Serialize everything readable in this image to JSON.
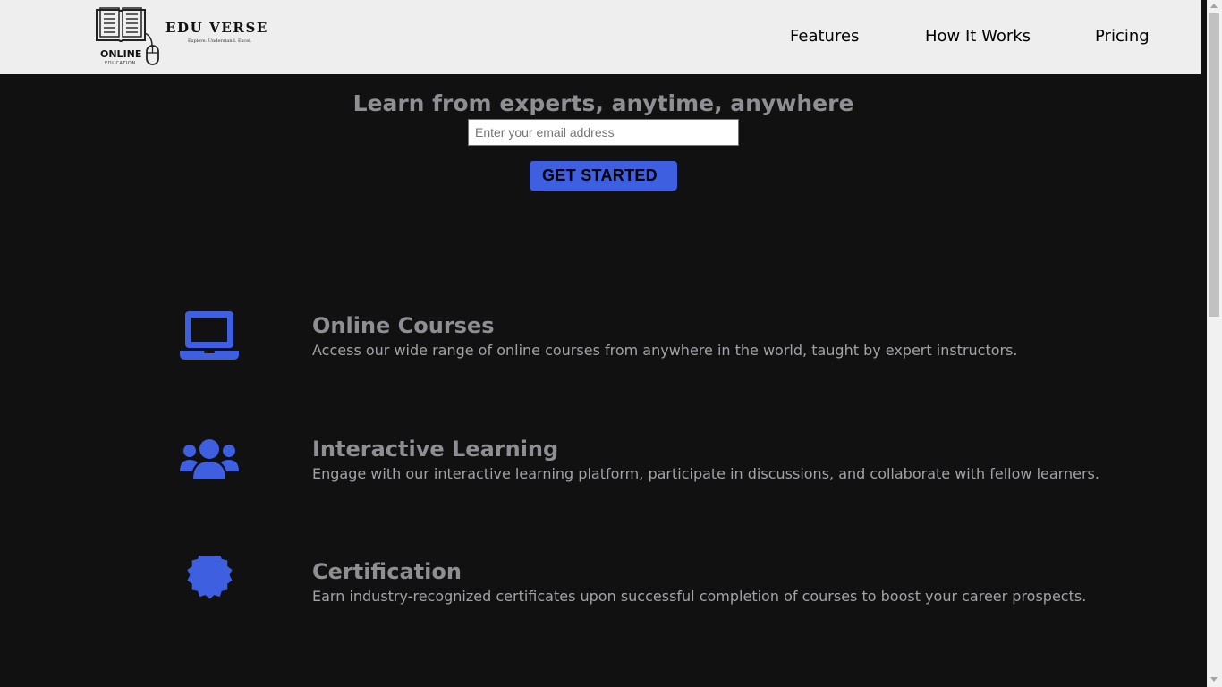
{
  "brand": {
    "name": "EDU VERSE",
    "tagline": "Explore. Understand. Excel.",
    "badge_top": "ONLINE",
    "badge_bottom": "EDUCATION"
  },
  "nav": {
    "items": [
      {
        "label": "Features"
      },
      {
        "label": "How It Works"
      },
      {
        "label": "Pricing"
      }
    ]
  },
  "hero": {
    "title": "Learn from experts, anytime, anywhere",
    "email_placeholder": "Enter your email address",
    "email_value": "",
    "cta_label": "GET STARTED"
  },
  "features": [
    {
      "icon": "laptop-icon",
      "title": "Online Courses",
      "description": "Access our wide range of online courses from anywhere in the world, taught by expert instructors."
    },
    {
      "icon": "users-icon",
      "title": "Interactive Learning",
      "description": "Engage with our interactive learning platform, participate in discussions, and collaborate with fellow learners."
    },
    {
      "icon": "certificate-icon",
      "title": "Certification",
      "description": "Earn industry-recognized certificates upon successful completion of courses to boost your career prospects."
    }
  ],
  "colors": {
    "background": "#111111",
    "header_background": "#eeeeee",
    "accent": "#3d5fe0",
    "heading_text": "#8e8e93",
    "body_text": "#a2a2a7"
  }
}
